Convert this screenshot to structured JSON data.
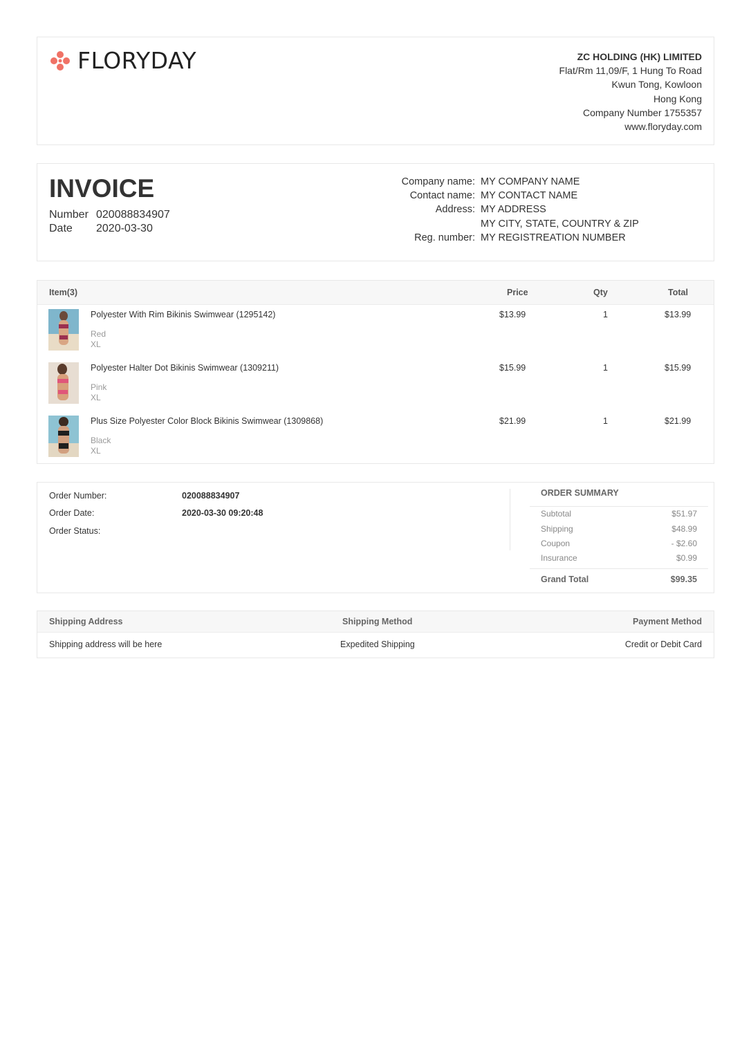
{
  "brand": {
    "name": "FLORYDAY",
    "accent": "#f07266"
  },
  "company": {
    "name": "ZC HOLDING (HK) LIMITED",
    "lines": [
      "Flat/Rm 11,09/F, 1 Hung To Road",
      "Kwun Tong, Kowloon",
      "Hong Kong",
      "Company Number 1755357",
      "www.floryday.com"
    ]
  },
  "invoice": {
    "title": "INVOICE",
    "number_label": "Number",
    "number": "020088834907",
    "date_label": "Date",
    "date": "2020-03-30"
  },
  "client": {
    "company_label": "Company name:",
    "company": "MY COMPANY NAME",
    "contact_label": "Contact name:",
    "contact": "MY CONTACT NAME",
    "address_label": "Address:",
    "address1": "MY ADDRESS",
    "address2": "MY CITY, STATE, COUNTRY & ZIP",
    "reg_label": "Reg. number:",
    "reg": "MY REGISTREATION NUMBER"
  },
  "items_table": {
    "headers": {
      "item": "Item(3)",
      "price": "Price",
      "qty": "Qty",
      "total": "Total"
    },
    "rows": [
      {
        "name": "Polyester With Rim Bikinis Swimwear (1295142)",
        "color": "Red",
        "size": "XL",
        "price": "$13.99",
        "qty": "1",
        "total": "$13.99"
      },
      {
        "name": "Polyester Halter Dot Bikinis Swimwear (1309211)",
        "color": "Pink",
        "size": "XL",
        "price": "$15.99",
        "qty": "1",
        "total": "$15.99"
      },
      {
        "name": "Plus Size Polyester Color Block Bikinis Swimwear (1309868)",
        "color": "Black",
        "size": "XL",
        "price": "$21.99",
        "qty": "1",
        "total": "$21.99"
      }
    ]
  },
  "order": {
    "number_label": "Order Number:",
    "number": "020088834907",
    "date_label": "Order Date:",
    "date": "2020-03-30 09:20:48",
    "status_label": "Order Status:",
    "status": ""
  },
  "summary": {
    "title": "ORDER SUMMARY",
    "subtotal_label": "Subtotal",
    "subtotal": "$51.97",
    "shipping_label": "Shipping",
    "shipping": "$48.99",
    "coupon_label": "Coupon",
    "coupon": "- $2.60",
    "insurance_label": "Insurance",
    "insurance": "$0.99",
    "grand_label": "Grand Total",
    "grand": "$99.35"
  },
  "shipping": {
    "address_label": "Shipping Address",
    "address": "Shipping address will be here",
    "method_label": "Shipping Method",
    "method": "Expedited Shipping",
    "payment_label": "Payment Method",
    "payment": "Credit or Debit Card"
  }
}
